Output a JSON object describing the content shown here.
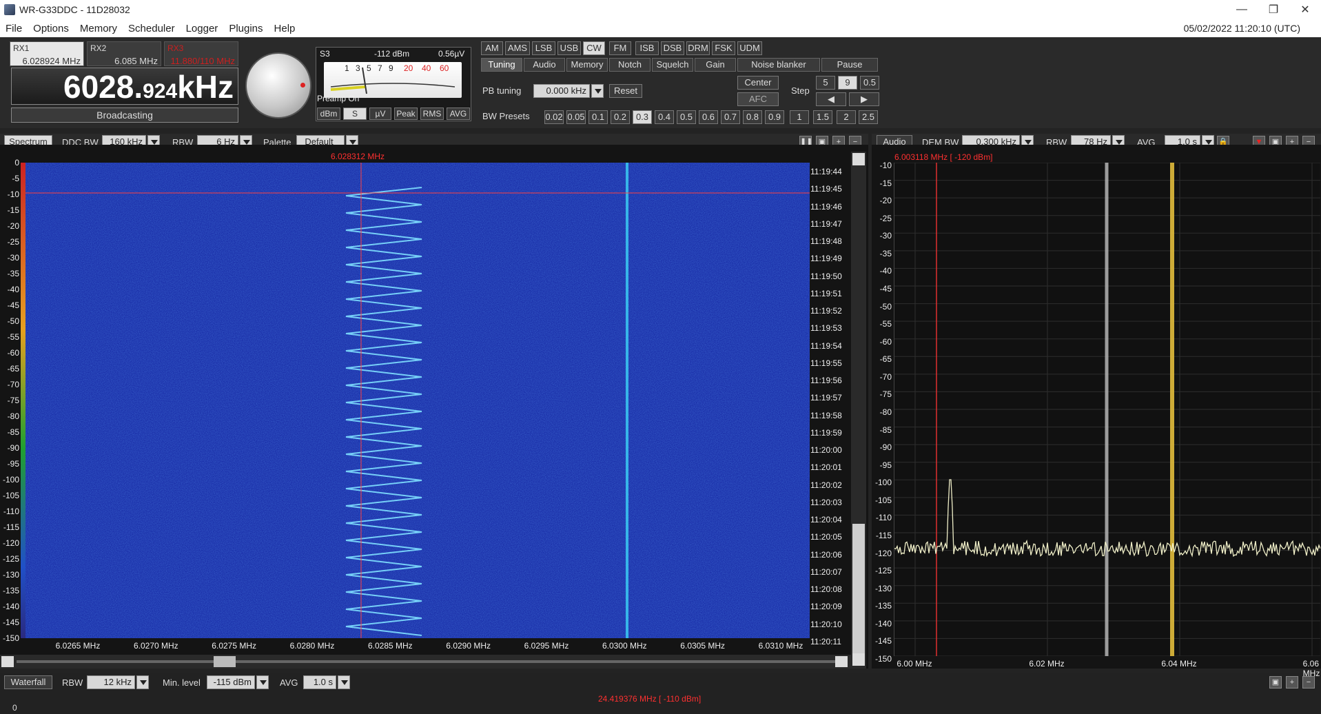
{
  "window": {
    "title": "WR-G33DDC - 11D28032",
    "minimize_label": "—",
    "restore_label": "❐",
    "close_label": "✕"
  },
  "menu": {
    "items": [
      "File",
      "Options",
      "Memory",
      "Scheduler",
      "Logger",
      "Plugins",
      "Help"
    ],
    "clock": "05/02/2022 11:20:10 (UTC)"
  },
  "receivers": [
    {
      "name": "RX1",
      "freq": "6.028924 MHz"
    },
    {
      "name": "RX2",
      "freq": "6.085 MHz"
    },
    {
      "name": "RX3",
      "freq": "11.880/110 MHz"
    }
  ],
  "frequency": {
    "main": "6028.",
    "fraction": "924",
    "unit": "kHz",
    "band": "Broadcasting"
  },
  "smeter": {
    "s_label": "S3",
    "dbm": "-112 dBm",
    "uv": "0.56µV",
    "scale_black": [
      "1",
      "3",
      "5",
      "7",
      "9"
    ],
    "scale_red": [
      "20",
      "40",
      "60"
    ],
    "preamp": "Preamp On",
    "buttons": [
      "dBm",
      "S",
      "µV",
      "Peak",
      "RMS",
      "AVG"
    ],
    "active_button": "S"
  },
  "modes": {
    "items": [
      "AM",
      "AMS",
      "LSB",
      "USB",
      "CW",
      "FM",
      "ISB",
      "DSB",
      "DRM",
      "FSK",
      "UDM"
    ],
    "active": "CW"
  },
  "tabs": {
    "items": [
      "Tuning",
      "Audio",
      "Memory",
      "Notch",
      "Squelch",
      "Gain",
      "Noise blanker",
      "Pause"
    ],
    "active": "Tuning"
  },
  "tuning": {
    "pb_label": "PB tuning",
    "pb_value": "0.000 kHz",
    "reset": "Reset",
    "center": "Center",
    "afc": "AFC",
    "step_label": "Step",
    "step_options": [
      "5",
      "9",
      "0.5"
    ],
    "step_active": "9",
    "step_left": "◀",
    "step_right": "▶",
    "bw_label": "BW Presets",
    "bw_presets": [
      "0.02",
      "0.05",
      "0.1",
      "0.2",
      "0.3",
      "0.4",
      "0.5",
      "0.6",
      "0.7",
      "0.8",
      "0.9",
      "1",
      "1.5",
      "2",
      "2.5"
    ],
    "bw_active": "0.3"
  },
  "spectrum_toolbar": {
    "title": "Spectrum",
    "ddc_label": "DDC BW",
    "ddc_value": "160 kHz",
    "rbw_label": "RBW",
    "rbw_value": "6 Hz",
    "palette_label": "Palette",
    "palette_value": "Default"
  },
  "spectrum": {
    "cursor_label": "6.028312 MHz",
    "y_labels": [
      "0",
      "-5",
      "-10",
      "-15",
      "-20",
      "-25",
      "-30",
      "-35",
      "-40",
      "-45",
      "-50",
      "-55",
      "-60",
      "-65",
      "-70",
      "-75",
      "-80",
      "-85",
      "-90",
      "-95",
      "-100",
      "-105",
      "-110",
      "-115",
      "-120",
      "-125",
      "-130",
      "-135",
      "-140",
      "-145",
      "-150"
    ],
    "time_labels": [
      "11:19:44",
      "11:19:45",
      "11:19:46",
      "11:19:47",
      "11:19:48",
      "11:19:49",
      "11:19:50",
      "11:19:51",
      "11:19:52",
      "11:19:53",
      "11:19:54",
      "11:19:55",
      "11:19:56",
      "11:19:57",
      "11:19:58",
      "11:19:59",
      "11:20:00",
      "11:20:01",
      "11:20:02",
      "11:20:03",
      "11:20:04",
      "11:20:05",
      "11:20:06",
      "11:20:07",
      "11:20:08",
      "11:20:09",
      "11:20:10",
      "11:20:11"
    ],
    "x_labels": [
      "6.0265 MHz",
      "6.0270 MHz",
      "6.0275 MHz",
      "6.0280 MHz",
      "6.0285 MHz",
      "6.0290 MHz",
      "6.0295 MHz",
      "6.0300 MHz",
      "6.0305 MHz",
      "6.0310 MHz"
    ]
  },
  "audio_toolbar": {
    "title": "Audio",
    "dem_label": "DEM BW",
    "dem_value": "0.300 kHz",
    "rbw_label": "RBW",
    "rbw_value": "78 Hz",
    "avg_label": "AVG",
    "avg_value": "1.0 s"
  },
  "audio": {
    "cursor_label": "6.003118 MHz [ -120 dBm]",
    "y_labels": [
      "-10",
      "-15",
      "-20",
      "-25",
      "-30",
      "-35",
      "-40",
      "-45",
      "-50",
      "-55",
      "-60",
      "-65",
      "-70",
      "-75",
      "-80",
      "-85",
      "-90",
      "-95",
      "-100",
      "-105",
      "-110",
      "-115",
      "-120",
      "-125",
      "-130",
      "-135",
      "-140",
      "-145",
      "-150"
    ],
    "x_labels": [
      "6.00 MHz",
      "6.02 MHz",
      "6.04 MHz",
      "6.06 MHz"
    ]
  },
  "waterfall_bar": {
    "title": "Waterfall",
    "rbw_label": "RBW",
    "rbw_value": "12 kHz",
    "min_label": "Min. level",
    "min_value": "-115 dBm",
    "avg_label": "AVG",
    "avg_value": "1.0 s",
    "cursor_label": "24.419376 MHz [ -110 dBm]",
    "y_first": "0"
  },
  "colors": {
    "waterfall_bg": "#1c2fa8",
    "cursor_red": "#ff3030",
    "trace": "#f0efc8",
    "marker_yellow": "#d8b43a"
  }
}
